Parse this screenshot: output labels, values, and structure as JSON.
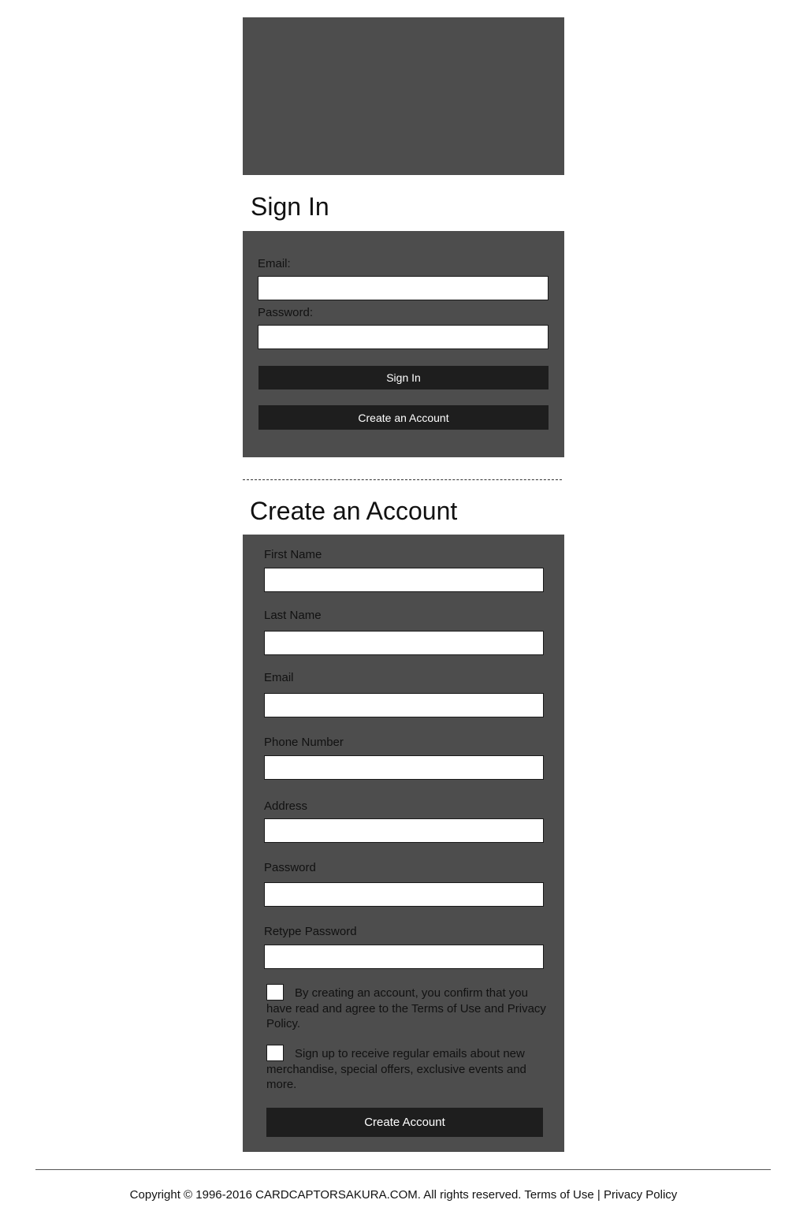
{
  "signin": {
    "heading": "Sign In",
    "email_label": "Email:",
    "email_value": "",
    "password_label": "Password:",
    "password_value": "",
    "signin_button": "Sign In",
    "create_account_button": "Create an Account"
  },
  "create_account": {
    "heading": "Create an Account",
    "fields": [
      {
        "label": "First Name",
        "value": ""
      },
      {
        "label": "Last Name",
        "value": ""
      },
      {
        "label": "Email",
        "value": ""
      },
      {
        "label": "Phone Number",
        "value": ""
      },
      {
        "label": "Address",
        "value": ""
      },
      {
        "label": "Password",
        "value": ""
      },
      {
        "label": "Retype Password",
        "value": ""
      }
    ],
    "terms_checkbox": {
      "checked": false,
      "text": "By creating an account, you confirm that you have read and agree to the Terms of  Use and Privacy Policy."
    },
    "newsletter_checkbox": {
      "checked": false,
      "text": "Sign up to receive regular emails about new merchandise, special offers, exclusive events and more."
    },
    "submit_button": "Create Account"
  },
  "footer": {
    "copyright": "Copyright © 1996-2016 CARDCAPTORSAKURA.COM. All rights reserved. ",
    "terms_link": "Terms of Use",
    "separator": " | ",
    "privacy_link": "Privacy Policy"
  },
  "colors": {
    "panel_bg": "#4d4d4d",
    "button_bg": "#1e1e1e",
    "page_bg": "#ffffff"
  }
}
